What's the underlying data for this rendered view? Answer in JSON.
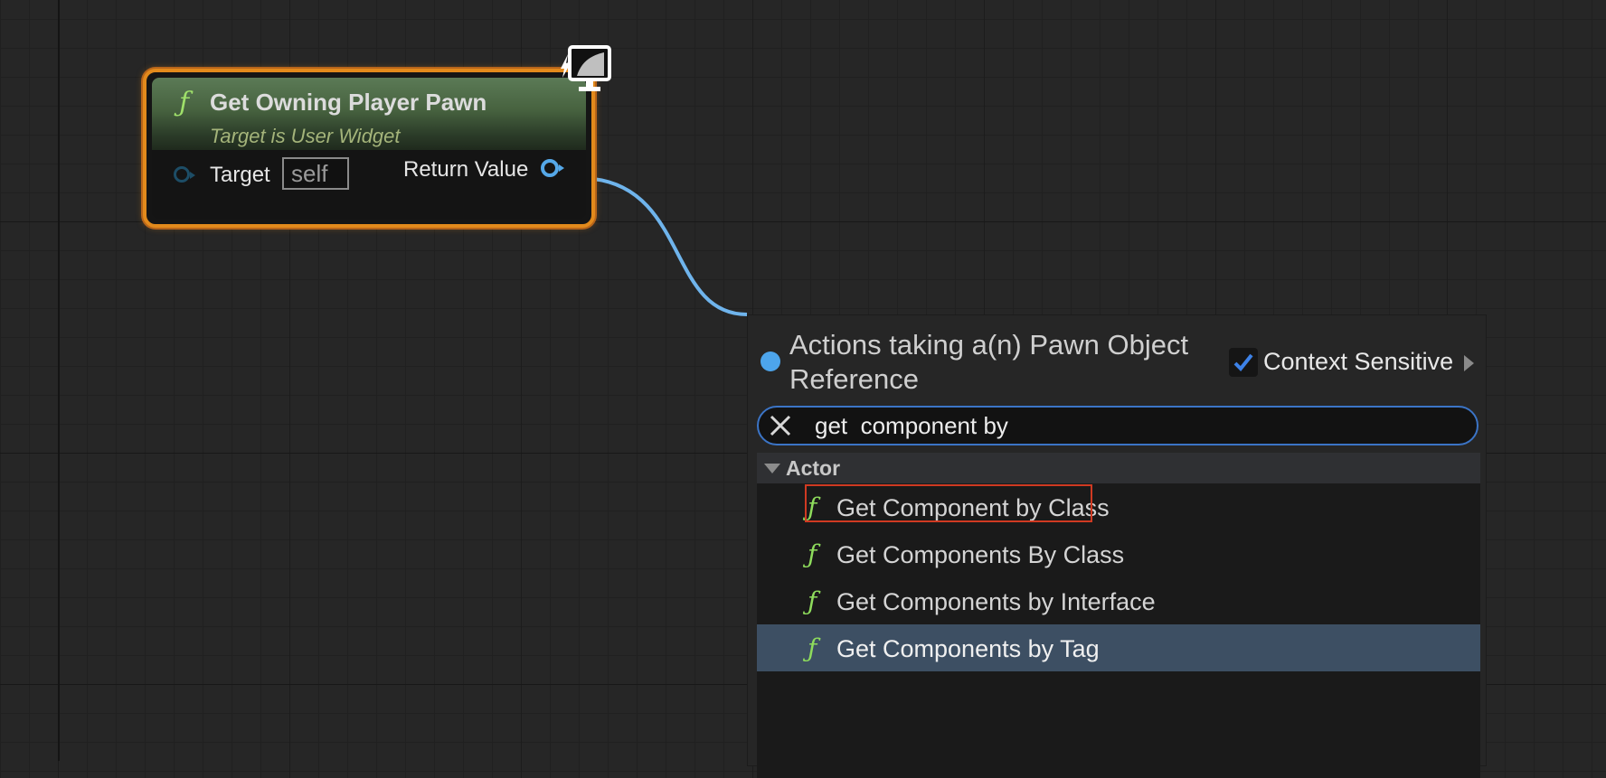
{
  "node": {
    "title": "Get Owning Player Pawn",
    "subtitle": "Target is User Widget",
    "function_icon": "ƒ",
    "target_label": "Target",
    "target_value": "self",
    "return_label": "Return Value",
    "corner_icon": "widget-monitor-icon"
  },
  "menu": {
    "title": "Actions taking a(n) Pawn Object Reference",
    "context_sensitive_label": "Context Sensitive",
    "context_sensitive_checked": true,
    "search_value": "get  component by",
    "category": "Actor",
    "items": [
      {
        "label": "Get Component by Class",
        "icon": "ƒ"
      },
      {
        "label": "Get Components By Class",
        "icon": "ƒ"
      },
      {
        "label": "Get Components by Interface",
        "icon": "ƒ"
      },
      {
        "label": "Get Components by Tag",
        "icon": "ƒ"
      }
    ],
    "selected_index": 3,
    "highlighted_index": 0
  },
  "colors": {
    "node_border": "#e28a1c",
    "wire": "#6fb4ec",
    "accent_blue": "#4da5ec",
    "selected_row": "#3d4f63",
    "highlight_box": "#d03a22"
  }
}
